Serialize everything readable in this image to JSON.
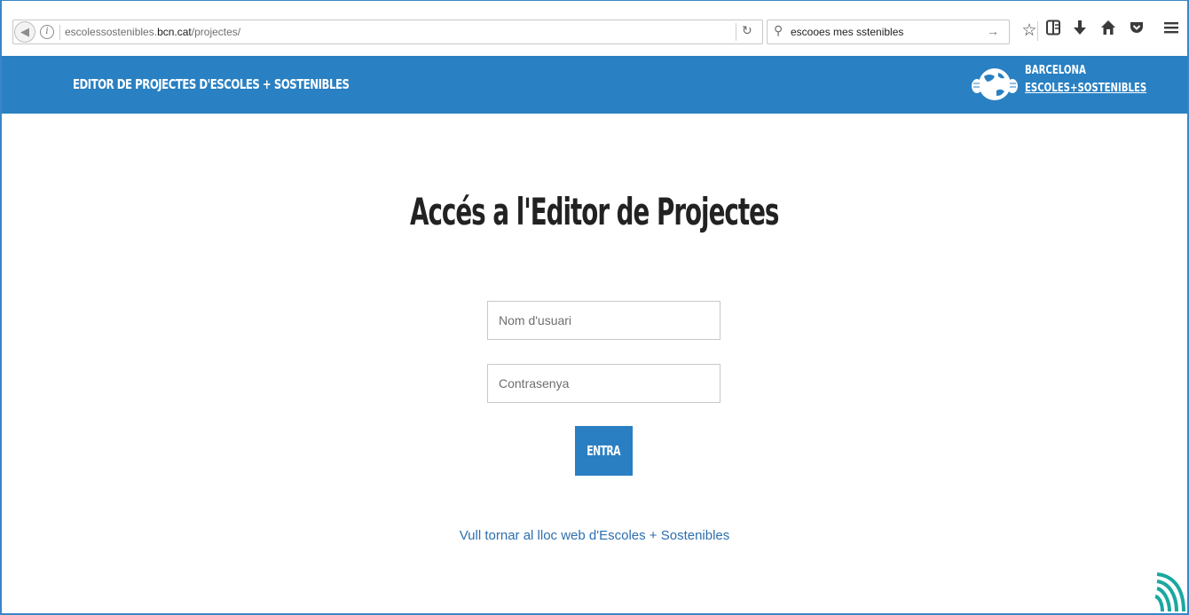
{
  "browser": {
    "url_prefix": "escolessostenibles.",
    "url_domain": "bcn.cat",
    "url_path": "/projectes/",
    "search_query": "escooes mes sstenibles",
    "icons": [
      "back-icon",
      "info-icon",
      "reload-icon",
      "search-icon",
      "go-arrow-icon",
      "bookmark-star-icon",
      "reading-list-icon",
      "download-icon",
      "home-icon",
      "pocket-icon",
      "menu-icon"
    ]
  },
  "header": {
    "title": "EDITOR DE PROJECTES D'ESCOLES + SOSTENIBLES",
    "brand_line1": "BARCELONA",
    "brand_line2": "ESCOLES+SOSTENIBLES",
    "bg_color": "#2980c2"
  },
  "login": {
    "heading": "Accés a l'Editor de Projectes",
    "username_placeholder": "Nom d'usuari",
    "password_placeholder": "Contrasenya",
    "submit_label": "ENTRA",
    "back_link": "Vull tornar al lloc web d'Escoles + Sostenibles"
  }
}
